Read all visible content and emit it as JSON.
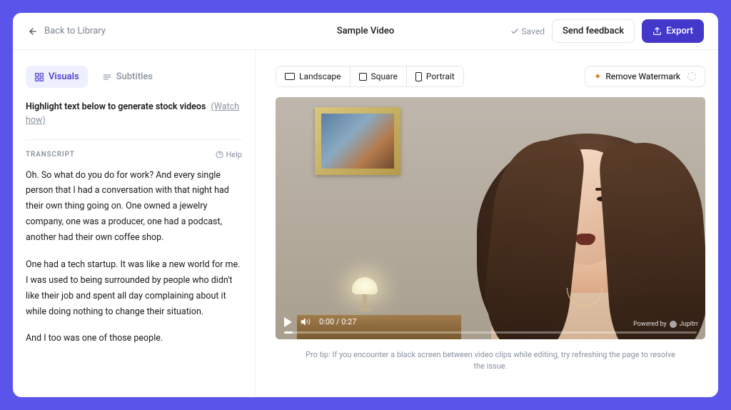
{
  "header": {
    "back_label": "Back to Library",
    "title": "Sample Video",
    "saved_label": "Saved",
    "feedback_label": "Send feedback",
    "export_label": "Export"
  },
  "left": {
    "tab_visuals": "Visuals",
    "tab_subtitles": "Subtitles",
    "instruction": "Highlight text below to generate stock videos",
    "watch_how": "(Watch how)",
    "transcript_label": "TRANSCRIPT",
    "help_label": "Help",
    "transcript_p1": "Oh. So what do you do for work? And every single person that I had a conversation with that night had their own thing going on. One owned a jewelry company, one was a producer, one had a podcast, another had their own coffee shop.",
    "transcript_p2": "One had a tech startup. It was like a new world for me. I was used to being surrounded by people who didn't like their job and spent all day complaining about it while doing nothing to change their situation.",
    "transcript_p3": "And I too was one of those people."
  },
  "right": {
    "aspect_landscape": "Landscape",
    "aspect_square": "Square",
    "aspect_portrait": "Portrait",
    "remove_watermark": "Remove Watermark",
    "time_display": "0:00 / 0:27",
    "powered_by_prefix": "Powered by",
    "powered_by_brand": "Jupitrr",
    "pro_tip": "Pro tip: If you encounter a black screen between video clips while editing, try refreshing the page to resolve the issue."
  },
  "colors": {
    "accent": "#4338ca",
    "page_bg": "#5b54ea"
  }
}
